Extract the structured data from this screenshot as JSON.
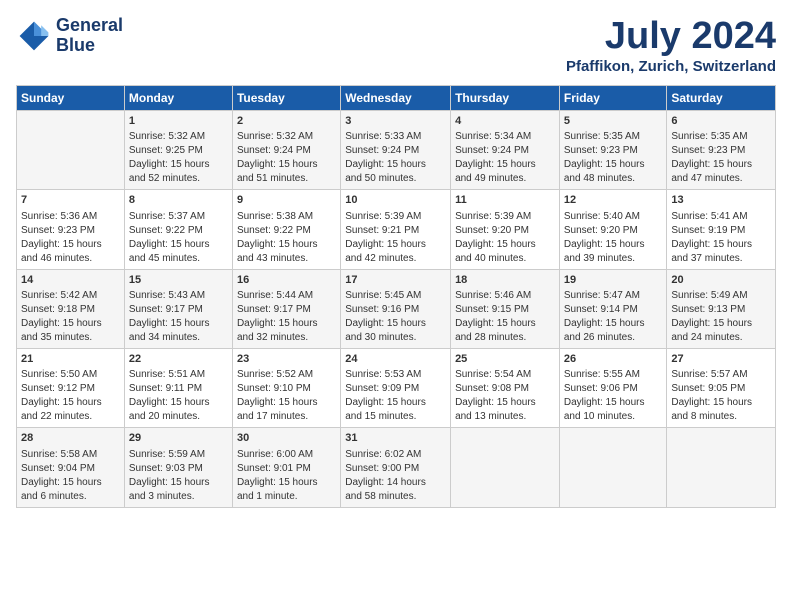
{
  "header": {
    "logo_line1": "General",
    "logo_line2": "Blue",
    "month_year": "July 2024",
    "location": "Pfaffikon, Zurich, Switzerland"
  },
  "days_of_week": [
    "Sunday",
    "Monday",
    "Tuesday",
    "Wednesday",
    "Thursday",
    "Friday",
    "Saturday"
  ],
  "weeks": [
    [
      {
        "day": "",
        "info": ""
      },
      {
        "day": "1",
        "info": "Sunrise: 5:32 AM\nSunset: 9:25 PM\nDaylight: 15 hours\nand 52 minutes."
      },
      {
        "day": "2",
        "info": "Sunrise: 5:32 AM\nSunset: 9:24 PM\nDaylight: 15 hours\nand 51 minutes."
      },
      {
        "day": "3",
        "info": "Sunrise: 5:33 AM\nSunset: 9:24 PM\nDaylight: 15 hours\nand 50 minutes."
      },
      {
        "day": "4",
        "info": "Sunrise: 5:34 AM\nSunset: 9:24 PM\nDaylight: 15 hours\nand 49 minutes."
      },
      {
        "day": "5",
        "info": "Sunrise: 5:35 AM\nSunset: 9:23 PM\nDaylight: 15 hours\nand 48 minutes."
      },
      {
        "day": "6",
        "info": "Sunrise: 5:35 AM\nSunset: 9:23 PM\nDaylight: 15 hours\nand 47 minutes."
      }
    ],
    [
      {
        "day": "7",
        "info": "Sunrise: 5:36 AM\nSunset: 9:23 PM\nDaylight: 15 hours\nand 46 minutes."
      },
      {
        "day": "8",
        "info": "Sunrise: 5:37 AM\nSunset: 9:22 PM\nDaylight: 15 hours\nand 45 minutes."
      },
      {
        "day": "9",
        "info": "Sunrise: 5:38 AM\nSunset: 9:22 PM\nDaylight: 15 hours\nand 43 minutes."
      },
      {
        "day": "10",
        "info": "Sunrise: 5:39 AM\nSunset: 9:21 PM\nDaylight: 15 hours\nand 42 minutes."
      },
      {
        "day": "11",
        "info": "Sunrise: 5:39 AM\nSunset: 9:20 PM\nDaylight: 15 hours\nand 40 minutes."
      },
      {
        "day": "12",
        "info": "Sunrise: 5:40 AM\nSunset: 9:20 PM\nDaylight: 15 hours\nand 39 minutes."
      },
      {
        "day": "13",
        "info": "Sunrise: 5:41 AM\nSunset: 9:19 PM\nDaylight: 15 hours\nand 37 minutes."
      }
    ],
    [
      {
        "day": "14",
        "info": "Sunrise: 5:42 AM\nSunset: 9:18 PM\nDaylight: 15 hours\nand 35 minutes."
      },
      {
        "day": "15",
        "info": "Sunrise: 5:43 AM\nSunset: 9:17 PM\nDaylight: 15 hours\nand 34 minutes."
      },
      {
        "day": "16",
        "info": "Sunrise: 5:44 AM\nSunset: 9:17 PM\nDaylight: 15 hours\nand 32 minutes."
      },
      {
        "day": "17",
        "info": "Sunrise: 5:45 AM\nSunset: 9:16 PM\nDaylight: 15 hours\nand 30 minutes."
      },
      {
        "day": "18",
        "info": "Sunrise: 5:46 AM\nSunset: 9:15 PM\nDaylight: 15 hours\nand 28 minutes."
      },
      {
        "day": "19",
        "info": "Sunrise: 5:47 AM\nSunset: 9:14 PM\nDaylight: 15 hours\nand 26 minutes."
      },
      {
        "day": "20",
        "info": "Sunrise: 5:49 AM\nSunset: 9:13 PM\nDaylight: 15 hours\nand 24 minutes."
      }
    ],
    [
      {
        "day": "21",
        "info": "Sunrise: 5:50 AM\nSunset: 9:12 PM\nDaylight: 15 hours\nand 22 minutes."
      },
      {
        "day": "22",
        "info": "Sunrise: 5:51 AM\nSunset: 9:11 PM\nDaylight: 15 hours\nand 20 minutes."
      },
      {
        "day": "23",
        "info": "Sunrise: 5:52 AM\nSunset: 9:10 PM\nDaylight: 15 hours\nand 17 minutes."
      },
      {
        "day": "24",
        "info": "Sunrise: 5:53 AM\nSunset: 9:09 PM\nDaylight: 15 hours\nand 15 minutes."
      },
      {
        "day": "25",
        "info": "Sunrise: 5:54 AM\nSunset: 9:08 PM\nDaylight: 15 hours\nand 13 minutes."
      },
      {
        "day": "26",
        "info": "Sunrise: 5:55 AM\nSunset: 9:06 PM\nDaylight: 15 hours\nand 10 minutes."
      },
      {
        "day": "27",
        "info": "Sunrise: 5:57 AM\nSunset: 9:05 PM\nDaylight: 15 hours\nand 8 minutes."
      }
    ],
    [
      {
        "day": "28",
        "info": "Sunrise: 5:58 AM\nSunset: 9:04 PM\nDaylight: 15 hours\nand 6 minutes."
      },
      {
        "day": "29",
        "info": "Sunrise: 5:59 AM\nSunset: 9:03 PM\nDaylight: 15 hours\nand 3 minutes."
      },
      {
        "day": "30",
        "info": "Sunrise: 6:00 AM\nSunset: 9:01 PM\nDaylight: 15 hours\nand 1 minute."
      },
      {
        "day": "31",
        "info": "Sunrise: 6:02 AM\nSunset: 9:00 PM\nDaylight: 14 hours\nand 58 minutes."
      },
      {
        "day": "",
        "info": ""
      },
      {
        "day": "",
        "info": ""
      },
      {
        "day": "",
        "info": ""
      }
    ]
  ]
}
